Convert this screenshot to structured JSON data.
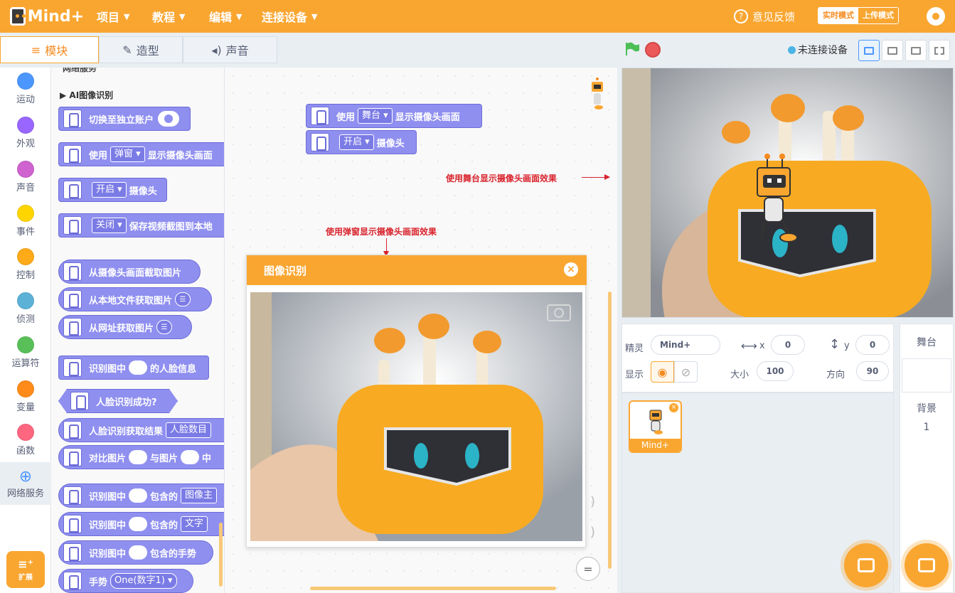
{
  "app": {
    "logo": "Mind+"
  },
  "menu": [
    {
      "label": "项目"
    },
    {
      "label": "教程"
    },
    {
      "label": "编辑"
    },
    {
      "label": "连接设备"
    }
  ],
  "topbar": {
    "feedback": "意见反馈",
    "mode_realtime": "实时模式",
    "mode_upload": "上传模式"
  },
  "tabs": {
    "blocks": "模块",
    "costumes": "造型",
    "sounds": "声音"
  },
  "categories": [
    {
      "label": "运动",
      "color": "#4c97ff"
    },
    {
      "label": "外观",
      "color": "#9966ff"
    },
    {
      "label": "声音",
      "color": "#cf63cf"
    },
    {
      "label": "事件",
      "color": "#ffd500"
    },
    {
      "label": "控制",
      "color": "#ffab19"
    },
    {
      "label": "侦测",
      "color": "#5cb1d6"
    },
    {
      "label": "运算符",
      "color": "#59c059"
    },
    {
      "label": "变量",
      "color": "#ff8c1a"
    },
    {
      "label": "函数",
      "color": "#ff6680"
    },
    {
      "label": "网络服务",
      "color": "#4c97ff"
    }
  ],
  "extension_label": "扩展",
  "palette": {
    "section_header": "网络服务",
    "subsection": "AI图像识别",
    "blocks": {
      "switch_account": "切换至独立账户",
      "use": "使用",
      "popup": "弹窗",
      "show_camera": "显示摄像头画面",
      "open": "开启",
      "camera": "摄像头",
      "close": "关闭",
      "save_snapshot": "保存视频截图到本地",
      "capture_from_camera": "从摄像头画面截取图片",
      "from_local_file": "从本地文件获取图片",
      "from_url": "从网址获取图片",
      "recognize_in": "识别图中",
      "face_info": "的人脸信息",
      "face_success": "人脸识别成功?",
      "face_result": "人脸识别获取结果",
      "face_count": "人脸数目",
      "compare_image": "对比图片",
      "with_image": "与图片",
      "middle": "中",
      "contains": "包含的",
      "image_main": "图像主",
      "text": "文字",
      "contains_gesture": "包含的手势",
      "gesture": "手势",
      "gesture_value": "One(数字1)"
    }
  },
  "workspace": {
    "use": "使用",
    "stage": "舞台",
    "show_camera": "显示摄像头画面",
    "open": "开启",
    "camera": "摄像头",
    "annotation_stage": "使用舞台显示摄像头画面效果",
    "annotation_popup": "使用弹窗显示摄像头画面效果",
    "zoom_reset": "="
  },
  "popup": {
    "title": "图像识别",
    "close": "×"
  },
  "stage_header": {
    "connection": "未连接设备"
  },
  "sprite_info": {
    "sprite_label": "精灵",
    "sprite_name": "Mind+",
    "x_label": "x",
    "x_value": "0",
    "y_label": "y",
    "y_value": "0",
    "show_label": "显示",
    "size_label": "大小",
    "size_value": "100",
    "direction_label": "方向",
    "direction_value": "90"
  },
  "sprites": [
    {
      "name": "Mind+"
    }
  ],
  "stage_panel": {
    "title": "舞台",
    "backdrop_label": "背景",
    "backdrop_count": "1"
  },
  "colors": {
    "accent": "#f9a631",
    "block": "#8f8ff0",
    "annotation": "#d9232d"
  }
}
